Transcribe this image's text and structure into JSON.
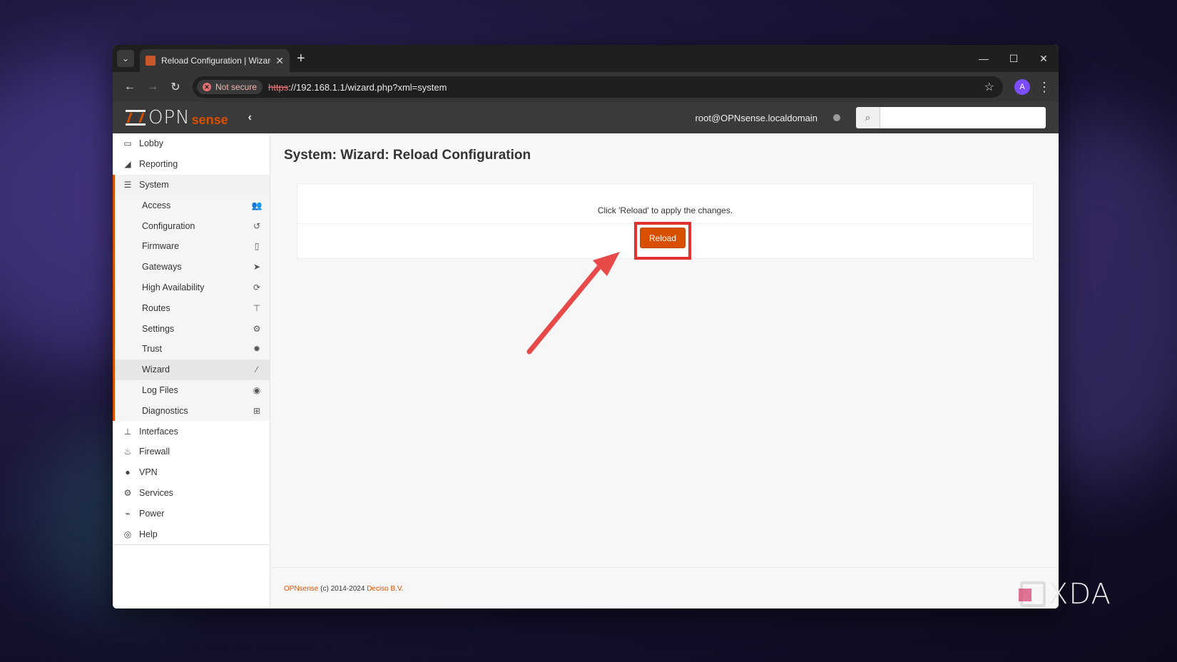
{
  "browser": {
    "tab_title": "Reload Configuration | Wizard |",
    "not_secure_label": "Not secure",
    "url_protocol": "https",
    "url_rest": "://192.168.1.1/wizard.php?xml=system",
    "profile_initial": "A"
  },
  "header": {
    "logo_opn": "OPN",
    "logo_sense": "sense",
    "user": "root@OPNsense.localdomain",
    "search_placeholder": ""
  },
  "sidebar": {
    "top_items": [
      {
        "label": "Lobby",
        "icon": "laptop-icon"
      },
      {
        "label": "Reporting",
        "icon": "area-chart-icon"
      },
      {
        "label": "System",
        "icon": "server-icon"
      }
    ],
    "system_items": [
      {
        "label": "Access",
        "icon": "users-icon"
      },
      {
        "label": "Configuration",
        "icon": "history-icon"
      },
      {
        "label": "Firmware",
        "icon": "tablet-icon"
      },
      {
        "label": "Gateways",
        "icon": "location-arrow-icon"
      },
      {
        "label": "High Availability",
        "icon": "refresh-icon"
      },
      {
        "label": "Routes",
        "icon": "map-signs-icon"
      },
      {
        "label": "Settings",
        "icon": "cogs-icon"
      },
      {
        "label": "Trust",
        "icon": "certificate-icon"
      },
      {
        "label": "Wizard",
        "icon": "magic-wand-icon"
      },
      {
        "label": "Log Files",
        "icon": "eye-icon"
      },
      {
        "label": "Diagnostics",
        "icon": "medkit-icon"
      }
    ],
    "bottom_items": [
      {
        "label": "Interfaces",
        "icon": "sitemap-icon"
      },
      {
        "label": "Firewall",
        "icon": "fire-icon"
      },
      {
        "label": "VPN",
        "icon": "globe-icon"
      },
      {
        "label": "Services",
        "icon": "cog-icon"
      },
      {
        "label": "Power",
        "icon": "plug-icon"
      },
      {
        "label": "Help",
        "icon": "life-ring-icon"
      }
    ]
  },
  "main": {
    "title": "System: Wizard: Reload Configuration",
    "message": "Click 'Reload' to apply the changes.",
    "reload_label": "Reload"
  },
  "footer": {
    "brand": "OPNsense",
    "copyright": " (c) 2014-2024 ",
    "company": "Deciso B.V."
  },
  "watermark": "XDA",
  "colors": {
    "accent": "#d94f00",
    "highlight": "#e0322f",
    "header_bg": "#3a3a3a"
  }
}
